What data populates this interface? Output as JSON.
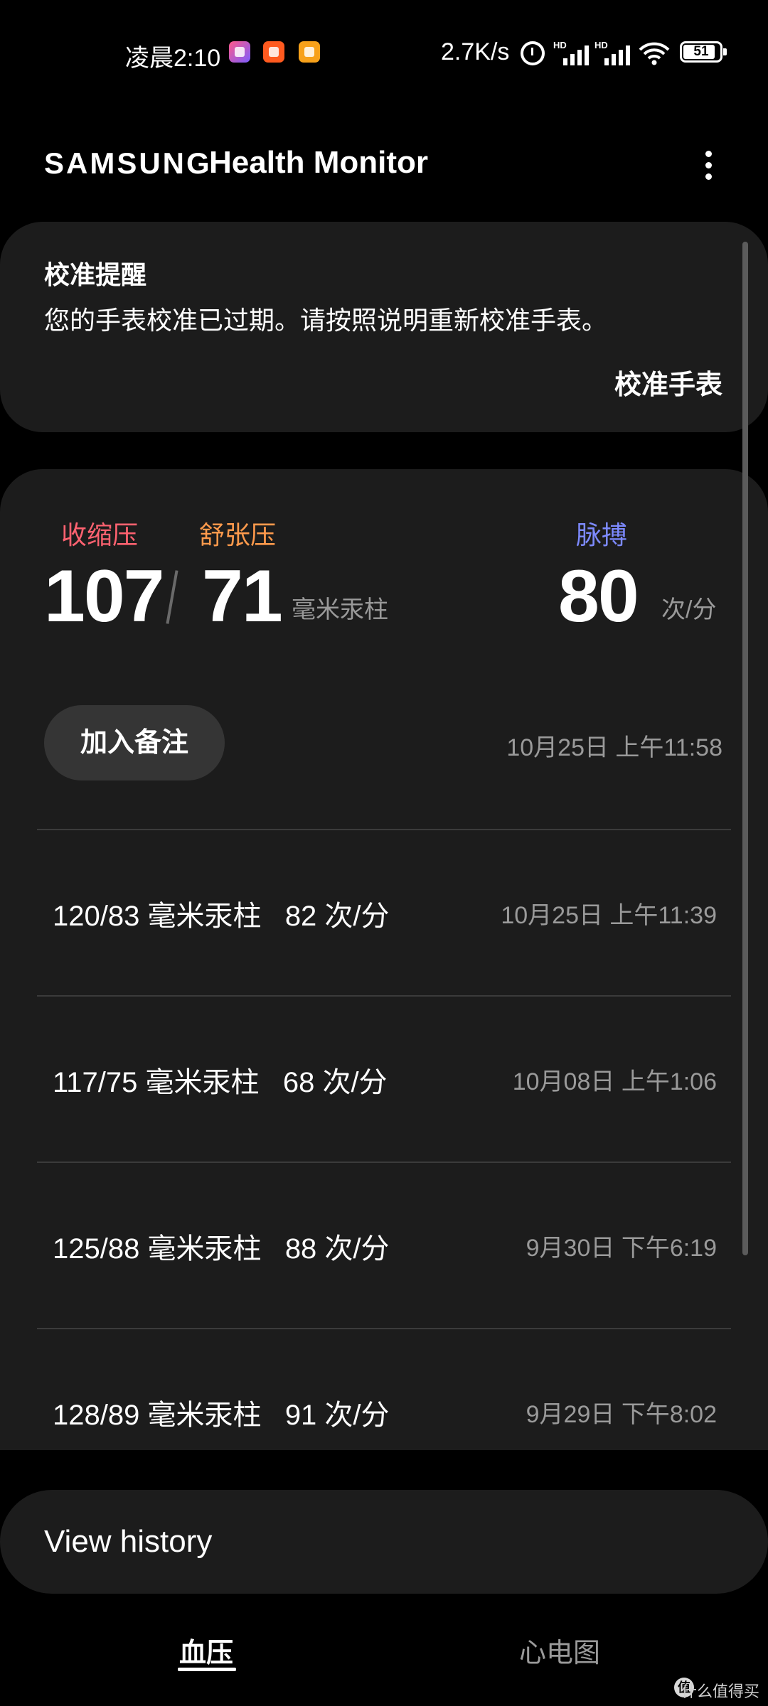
{
  "status_bar": {
    "time": "凌晨2:10",
    "net_speed": "2.7K/s",
    "battery": "51",
    "signal_badge_1": "HD",
    "signal_badge_2": "HD"
  },
  "header": {
    "brand": "SAMSUNG",
    "app_name": "Health Monitor"
  },
  "calibration": {
    "title": "校准提醒",
    "message": "您的手表校准已过期。请按照说明重新校准手表。",
    "action_label": "校准手表"
  },
  "latest": {
    "systolic_label": "收缩压",
    "diastolic_label": "舒张压",
    "pulse_label": "脉搏",
    "systolic": "107",
    "diastolic": "71",
    "bp_unit": "毫米汞柱",
    "pulse": "80",
    "pulse_unit": "次/分",
    "add_note_label": "加入备注",
    "timestamp": "10月25日 上午11:58"
  },
  "history": [
    {
      "bp": "120/83 毫米汞柱",
      "pulse": "82 次/分",
      "time": "10月25日 上午11:39"
    },
    {
      "bp": "117/75 毫米汞柱",
      "pulse": "68 次/分",
      "time": "10月08日 上午1:06"
    },
    {
      "bp": "125/88 毫米汞柱",
      "pulse": "88 次/分",
      "time": "9月30日 下午6:19"
    },
    {
      "bp": "128/89 毫米汞柱",
      "pulse": "91 次/分",
      "time": "9月29日 下午8:02"
    }
  ],
  "view_history_label": "View history",
  "tabs": {
    "bp": "血压",
    "ecg": "心电图"
  },
  "watermark": "什么值得买",
  "colors": {
    "background": "#000000",
    "card": "#1c1c1c",
    "systolic": "#ff6270",
    "diastolic": "#ff9a4c",
    "pulse": "#7d8aff"
  }
}
